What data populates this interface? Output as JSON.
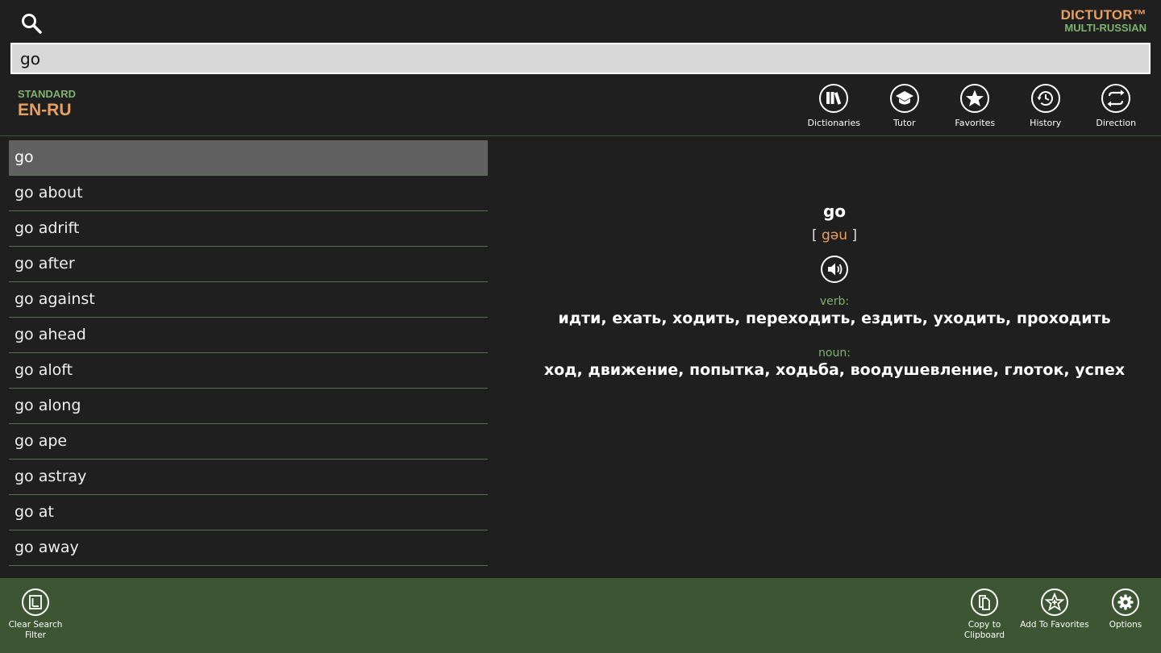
{
  "header": {
    "brand_title": "DICTUTOR™",
    "brand_subtitle": "MULTI-RUSSIAN",
    "search_value": "go"
  },
  "dictionary": {
    "type": "STANDARD",
    "pair": "EN-RU"
  },
  "toolbar": {
    "dictionaries": "Dictionaries",
    "tutor": "Tutor",
    "favorites": "Favorites",
    "history": "History",
    "direction": "Direction"
  },
  "word_list": [
    "go",
    "go about",
    "go adrift",
    "go after",
    "go against",
    "go ahead",
    "go aloft",
    "go along",
    "go ape",
    "go astray",
    "go at",
    "go away"
  ],
  "selected_index": 0,
  "entry": {
    "headword": "go",
    "bracket_open": "[",
    "pronunciation": "gəu",
    "bracket_close": "]",
    "pos1": "verb:",
    "translation1": "идти, ехать, ходить, переходить, ездить, уходить, проходить",
    "pos2": "noun:",
    "translation2": "ход, движение, попытка, ходьба, воодушевление, глоток, успех"
  },
  "bottom_bar": {
    "clear_filter": "Clear Search\nFilter",
    "copy": "Copy to\nClipboard",
    "add_favorites": "Add To Favorites",
    "options": "Options"
  },
  "colors": {
    "accent_orange": "#e8a060",
    "accent_green": "#7fb36e",
    "app_bar": "#3d5533",
    "background": "#1f1f1f"
  },
  "icons": [
    "search-icon",
    "books-icon",
    "graduation-cap-icon",
    "star-icon",
    "history-clock-icon",
    "swap-arrows-icon",
    "speaker-icon",
    "clear-filter-icon",
    "copy-icon",
    "star-plus-icon",
    "gear-icon"
  ]
}
